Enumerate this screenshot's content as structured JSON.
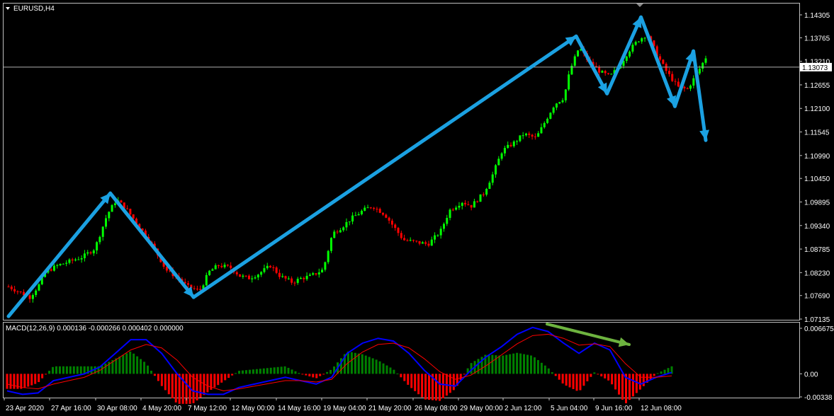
{
  "window": {
    "title": "EURUSD,H4"
  },
  "price_axis": {
    "ticks": [
      "1.14305",
      "1.13765",
      "1.13210",
      "1.12655",
      "1.12100",
      "1.11545",
      "1.10990",
      "1.10450",
      "1.09895",
      "1.09340",
      "1.08785",
      "1.08230",
      "1.07690",
      "1.07135"
    ],
    "current_price": "1.13073"
  },
  "macd_panel": {
    "label": "MACD(12,26,9) 0.000136 -0.000266 0.000402 0.000000",
    "ticks": [
      "0.006675",
      "0.00",
      "-0.00338"
    ]
  },
  "time_axis": {
    "ticks": [
      "23 Apr 2020",
      "27 Apr 16:00",
      "30 Apr 08:00",
      "4 May 20:00",
      "7 May 12:00",
      "12 May 00:00",
      "14 May 16:00",
      "19 May 04:00",
      "21 May 20:00",
      "26 May 08:00",
      "29 May 00:00",
      "2 Jun 12:00",
      "5 Jun 04:00",
      "9 Jun 16:00",
      "12 Jun 08:00"
    ]
  },
  "colors": {
    "bull": "#00ff00",
    "bear": "#ff0000",
    "wave": "#1ba1e2",
    "divergence": "#6db33f",
    "macd": "#0000ff",
    "signal": "#ff0000",
    "hist_pos": "#008000",
    "hist_neg": "#ff0000"
  },
  "chart_data": {
    "type": "candlestick",
    "symbol": "EURUSD",
    "timeframe": "H4",
    "ylim": [
      1.07135,
      1.14305
    ],
    "wave_annotation": [
      {
        "time": "23 Apr 2020",
        "price": 1.072
      },
      {
        "time": "30 Apr 12:00",
        "price": 1.101
      },
      {
        "time": "7 May 00:00",
        "price": 1.0765
      },
      {
        "time": "4 Jun 16:00",
        "price": 1.138
      },
      {
        "time": "8 Jun 08:00",
        "price": 1.1245
      },
      {
        "time": "10 Jun 04:00",
        "price": 1.1425
      },
      {
        "time": "12 Jun 00:00",
        "price": 1.1215
      },
      {
        "time": "13 Jun 08:00",
        "price": 1.1345
      },
      {
        "time": "15 Jun 16:00",
        "price": 1.1135
      }
    ],
    "price_path": [
      [
        "23 Apr 2020",
        1.079
      ],
      [
        "24 Apr 04:00",
        1.0765
      ],
      [
        "24 Apr 16:00",
        1.0795
      ],
      [
        "27 Apr 00:00",
        1.0825
      ],
      [
        "27 Apr 16:00",
        1.084
      ],
      [
        "28 Apr 08:00",
        1.085
      ],
      [
        "29 Apr 00:00",
        1.086
      ],
      [
        "29 Apr 16:00",
        1.088
      ],
      [
        "30 Apr 08:00",
        1.096
      ],
      [
        "30 Apr 20:00",
        1.0995
      ],
      [
        "1 May 08:00",
        1.0975
      ],
      [
        "4 May 00:00",
        1.0935
      ],
      [
        "4 May 12:00",
        1.0905
      ],
      [
        "5 May 00:00",
        1.087
      ],
      [
        "5 May 12:00",
        1.083
      ],
      [
        "6 May 04:00",
        1.081
      ],
      [
        "6 May 16:00",
        1.079
      ],
      [
        "7 May 08:00",
        1.078
      ],
      [
        "7 May 20:00",
        1.0825
      ],
      [
        "8 May 08:00",
        1.084
      ],
      [
        "11 May 00:00",
        1.0835
      ],
      [
        "11 May 12:00",
        1.0815
      ],
      [
        "12 May 00:00",
        1.081
      ],
      [
        "12 May 12:00",
        1.082
      ],
      [
        "13 May 04:00",
        1.084
      ],
      [
        "13 May 16:00",
        1.0815
      ],
      [
        "14 May 08:00",
        1.08
      ],
      [
        "14 May 20:00",
        1.081
      ],
      [
        "15 May 08:00",
        1.0815
      ],
      [
        "18 May 00:00",
        1.083
      ],
      [
        "18 May 12:00",
        1.0915
      ],
      [
        "19 May 00:00",
        1.093
      ],
      [
        "19 May 12:00",
        1.095
      ],
      [
        "20 May 04:00",
        1.097
      ],
      [
        "20 May 16:00",
        1.098
      ],
      [
        "21 May 08:00",
        1.096
      ],
      [
        "21 May 20:00",
        1.093
      ],
      [
        "22 May 08:00",
        1.09
      ],
      [
        "25 May 00:00",
        1.0895
      ],
      [
        "25 May 16:00",
        1.089
      ],
      [
        "26 May 08:00",
        1.092
      ],
      [
        "26 May 20:00",
        1.097
      ],
      [
        "27 May 12:00",
        1.099
      ],
      [
        "28 May 00:00",
        1.098
      ],
      [
        "28 May 16:00",
        1.101
      ],
      [
        "29 May 04:00",
        1.1055
      ],
      [
        "29 May 16:00",
        1.111
      ],
      [
        "1 Jun 08:00",
        1.113
      ],
      [
        "1 Jun 20:00",
        1.115
      ],
      [
        "2 Jun 12:00",
        1.114
      ],
      [
        "3 Jun 00:00",
        1.118
      ],
      [
        "3 Jun 12:00",
        1.122
      ],
      [
        "4 Jun 00:00",
        1.1235
      ],
      [
        "4 Jun 08:00",
        1.13
      ],
      [
        "4 Jun 20:00",
        1.1355
      ],
      [
        "5 Jun 08:00",
        1.132
      ],
      [
        "8 Jun 00:00",
        1.1295
      ],
      [
        "8 Jun 12:00",
        1.1285
      ],
      [
        "9 Jun 00:00",
        1.131
      ],
      [
        "9 Jun 12:00",
        1.1345
      ],
      [
        "10 Jun 00:00",
        1.137
      ],
      [
        "10 Jun 12:00",
        1.1385
      ],
      [
        "11 Jun 00:00",
        1.134
      ],
      [
        "11 Jun 12:00",
        1.13
      ],
      [
        "12 Jun 04:00",
        1.126
      ],
      [
        "12 Jun 16:00",
        1.1255
      ],
      [
        "15 Jun 04:00",
        1.129
      ],
      [
        "15 Jun 16:00",
        1.133
      ],
      [
        "16 Jun 04:00",
        1.1305
      ]
    ],
    "macd": {
      "params": "12,26,9",
      "ylim": [
        -0.00338,
        0.006675
      ],
      "macd_line": [
        -0.0025,
        -0.003,
        -0.0028,
        -0.001,
        -0.0005,
        0.0,
        0.001,
        0.003,
        0.005,
        0.005,
        0.003,
        0.0,
        -0.0025,
        -0.003,
        -0.003,
        -0.002,
        -0.0015,
        -0.001,
        -0.0005,
        -0.001,
        -0.0015,
        -0.0005,
        0.003,
        0.0045,
        0.0052,
        0.0048,
        0.003,
        0.0005,
        -0.0015,
        -0.0018,
        0.0005,
        0.0025,
        0.004,
        0.0058,
        0.0068,
        0.0062,
        0.0045,
        0.003,
        0.0045,
        0.0035,
        -0.0005,
        -0.0015,
        -0.0005,
        0.0002
      ],
      "signal_line": [
        -0.0015,
        -0.002,
        -0.0022,
        -0.0015,
        -0.001,
        -0.0005,
        0.0005,
        0.002,
        0.0035,
        0.0043,
        0.0038,
        0.002,
        -0.0005,
        -0.0018,
        -0.0025,
        -0.0022,
        -0.0018,
        -0.0014,
        -0.001,
        -0.001,
        -0.0012,
        -0.0008,
        0.0015,
        0.0032,
        0.0043,
        0.0045,
        0.0038,
        0.0022,
        0.0003,
        -0.0008,
        -0.0002,
        0.0012,
        0.0028,
        0.0044,
        0.0056,
        0.0058,
        0.0052,
        0.0042,
        0.0044,
        0.004,
        0.0015,
        -0.0005,
        -0.0005,
        -0.0003
      ]
    }
  }
}
